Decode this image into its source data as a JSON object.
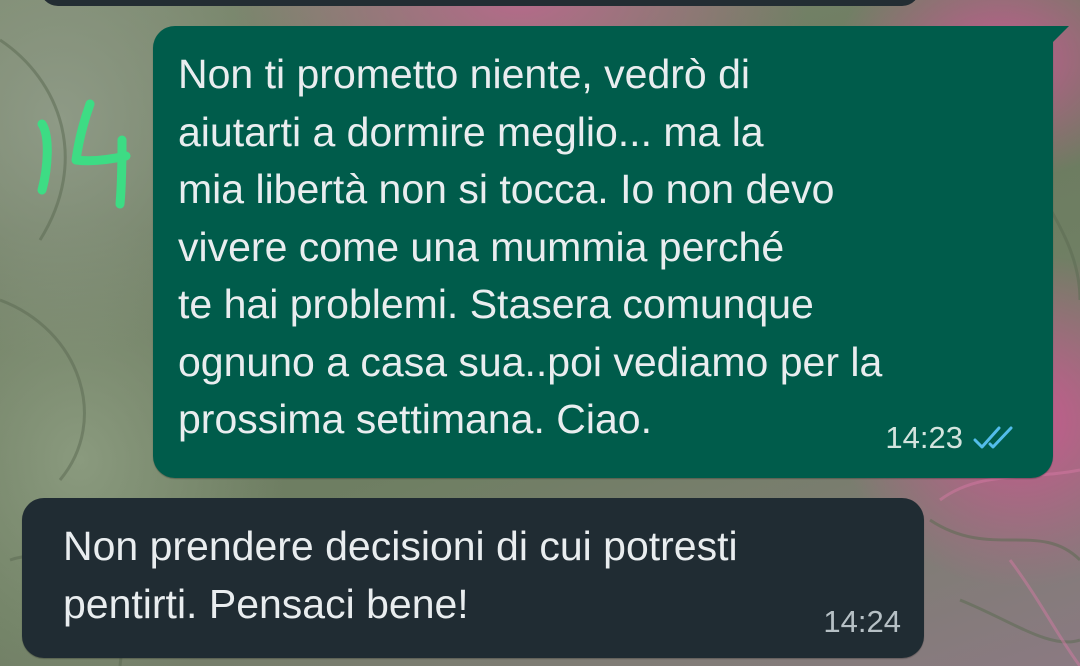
{
  "annotation": {
    "text": "14",
    "color": "#3ddc84"
  },
  "messages": [
    {
      "direction": "outgoing",
      "text": "Non ti prometto niente, vedrò di\naiutarti a dormire meglio... ma la\nmia libertà non si tocca. Io non devo\nvivere come una mummia perché\nte hai problemi. Stasera comunque\nognuno a casa sua..poi vediamo per la\nprossima settimana. Ciao.",
      "time": "14:23",
      "status": "read",
      "status_icon": "double-check-icon",
      "bubble_color": "#005c4b",
      "check_color": "#53bdeb"
    },
    {
      "direction": "incoming",
      "text": "Non prendere decisioni di cui potresti\npentirti. Pensaci bene!",
      "time": "14:24",
      "bubble_color": "#202c33"
    }
  ]
}
